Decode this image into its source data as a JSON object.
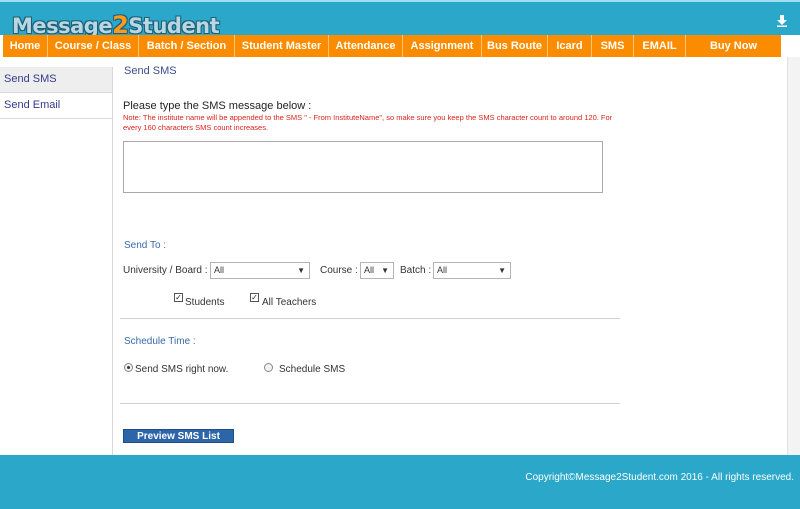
{
  "header": {
    "logo_part1": "Message",
    "logo_part2": "2",
    "logo_part3": "Student",
    "download_icon": "download-arrow-icon"
  },
  "nav": {
    "items": [
      "Home",
      "Course / Class",
      "Batch / Section",
      "Student Master",
      "Attendance",
      "Assignment",
      "Bus Route",
      "Icard",
      "SMS",
      "EMAIL",
      "Buy Now"
    ]
  },
  "sidebar": {
    "items": [
      "Send SMS",
      "Send Email"
    ]
  },
  "main": {
    "title": "Send SMS",
    "prompt": "Please type the SMS message below :",
    "note": "Note: The institute name will be appended to the SMS \" - From InstituteName\", so make sure you keep the SMS character count to around 120. For every 160 characters SMS count increases.",
    "message_value": "",
    "send_to_label": "Send To :",
    "university_label": "University / Board :",
    "university_value": "All",
    "course_label": "Course :",
    "course_value": "All",
    "batch_label": "Batch :",
    "batch_value": "All",
    "students_label": "Students",
    "students_checked": true,
    "teachers_label": "All Teachers",
    "teachers_checked": true,
    "schedule_label": "Schedule Time :",
    "send_now_label": "Send SMS right now.",
    "schedule_sms_label": "Schedule SMS",
    "selected_option": "send-now",
    "preview_button": "Preview SMS List"
  },
  "footer": {
    "copyright": "Copyright©Message2Student.com 2016 - All rights reserved."
  },
  "colors": {
    "header_bg": "#2aa7c9",
    "nav_bg": "#fb8c00",
    "button_bg": "#2c66a8",
    "note_text": "#d9231c"
  }
}
